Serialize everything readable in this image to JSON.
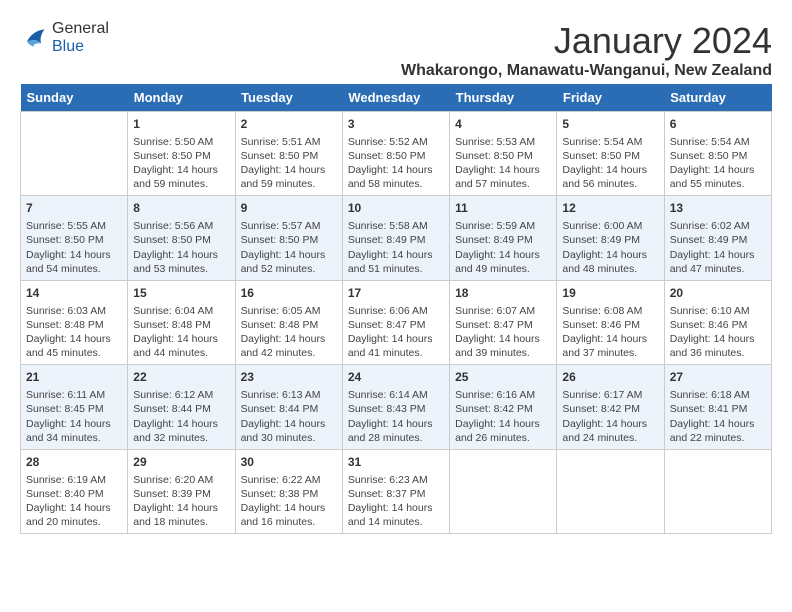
{
  "header": {
    "logo_line1": "General",
    "logo_line2": "Blue",
    "month": "January 2024",
    "location": "Whakarongo, Manawatu-Wanganui, New Zealand"
  },
  "days_of_week": [
    "Sunday",
    "Monday",
    "Tuesday",
    "Wednesday",
    "Thursday",
    "Friday",
    "Saturday"
  ],
  "weeks": [
    [
      {
        "day": "",
        "info": ""
      },
      {
        "day": "1",
        "info": "Sunrise: 5:50 AM\nSunset: 8:50 PM\nDaylight: 14 hours\nand 59 minutes."
      },
      {
        "day": "2",
        "info": "Sunrise: 5:51 AM\nSunset: 8:50 PM\nDaylight: 14 hours\nand 59 minutes."
      },
      {
        "day": "3",
        "info": "Sunrise: 5:52 AM\nSunset: 8:50 PM\nDaylight: 14 hours\nand 58 minutes."
      },
      {
        "day": "4",
        "info": "Sunrise: 5:53 AM\nSunset: 8:50 PM\nDaylight: 14 hours\nand 57 minutes."
      },
      {
        "day": "5",
        "info": "Sunrise: 5:54 AM\nSunset: 8:50 PM\nDaylight: 14 hours\nand 56 minutes."
      },
      {
        "day": "6",
        "info": "Sunrise: 5:54 AM\nSunset: 8:50 PM\nDaylight: 14 hours\nand 55 minutes."
      }
    ],
    [
      {
        "day": "7",
        "info": "Sunrise: 5:55 AM\nSunset: 8:50 PM\nDaylight: 14 hours\nand 54 minutes."
      },
      {
        "day": "8",
        "info": "Sunrise: 5:56 AM\nSunset: 8:50 PM\nDaylight: 14 hours\nand 53 minutes."
      },
      {
        "day": "9",
        "info": "Sunrise: 5:57 AM\nSunset: 8:50 PM\nDaylight: 14 hours\nand 52 minutes."
      },
      {
        "day": "10",
        "info": "Sunrise: 5:58 AM\nSunset: 8:49 PM\nDaylight: 14 hours\nand 51 minutes."
      },
      {
        "day": "11",
        "info": "Sunrise: 5:59 AM\nSunset: 8:49 PM\nDaylight: 14 hours\nand 49 minutes."
      },
      {
        "day": "12",
        "info": "Sunrise: 6:00 AM\nSunset: 8:49 PM\nDaylight: 14 hours\nand 48 minutes."
      },
      {
        "day": "13",
        "info": "Sunrise: 6:02 AM\nSunset: 8:49 PM\nDaylight: 14 hours\nand 47 minutes."
      }
    ],
    [
      {
        "day": "14",
        "info": "Sunrise: 6:03 AM\nSunset: 8:48 PM\nDaylight: 14 hours\nand 45 minutes."
      },
      {
        "day": "15",
        "info": "Sunrise: 6:04 AM\nSunset: 8:48 PM\nDaylight: 14 hours\nand 44 minutes."
      },
      {
        "day": "16",
        "info": "Sunrise: 6:05 AM\nSunset: 8:48 PM\nDaylight: 14 hours\nand 42 minutes."
      },
      {
        "day": "17",
        "info": "Sunrise: 6:06 AM\nSunset: 8:47 PM\nDaylight: 14 hours\nand 41 minutes."
      },
      {
        "day": "18",
        "info": "Sunrise: 6:07 AM\nSunset: 8:47 PM\nDaylight: 14 hours\nand 39 minutes."
      },
      {
        "day": "19",
        "info": "Sunrise: 6:08 AM\nSunset: 8:46 PM\nDaylight: 14 hours\nand 37 minutes."
      },
      {
        "day": "20",
        "info": "Sunrise: 6:10 AM\nSunset: 8:46 PM\nDaylight: 14 hours\nand 36 minutes."
      }
    ],
    [
      {
        "day": "21",
        "info": "Sunrise: 6:11 AM\nSunset: 8:45 PM\nDaylight: 14 hours\nand 34 minutes."
      },
      {
        "day": "22",
        "info": "Sunrise: 6:12 AM\nSunset: 8:44 PM\nDaylight: 14 hours\nand 32 minutes."
      },
      {
        "day": "23",
        "info": "Sunrise: 6:13 AM\nSunset: 8:44 PM\nDaylight: 14 hours\nand 30 minutes."
      },
      {
        "day": "24",
        "info": "Sunrise: 6:14 AM\nSunset: 8:43 PM\nDaylight: 14 hours\nand 28 minutes."
      },
      {
        "day": "25",
        "info": "Sunrise: 6:16 AM\nSunset: 8:42 PM\nDaylight: 14 hours\nand 26 minutes."
      },
      {
        "day": "26",
        "info": "Sunrise: 6:17 AM\nSunset: 8:42 PM\nDaylight: 14 hours\nand 24 minutes."
      },
      {
        "day": "27",
        "info": "Sunrise: 6:18 AM\nSunset: 8:41 PM\nDaylight: 14 hours\nand 22 minutes."
      }
    ],
    [
      {
        "day": "28",
        "info": "Sunrise: 6:19 AM\nSunset: 8:40 PM\nDaylight: 14 hours\nand 20 minutes."
      },
      {
        "day": "29",
        "info": "Sunrise: 6:20 AM\nSunset: 8:39 PM\nDaylight: 14 hours\nand 18 minutes."
      },
      {
        "day": "30",
        "info": "Sunrise: 6:22 AM\nSunset: 8:38 PM\nDaylight: 14 hours\nand 16 minutes."
      },
      {
        "day": "31",
        "info": "Sunrise: 6:23 AM\nSunset: 8:37 PM\nDaylight: 14 hours\nand 14 minutes."
      },
      {
        "day": "",
        "info": ""
      },
      {
        "day": "",
        "info": ""
      },
      {
        "day": "",
        "info": ""
      }
    ]
  ]
}
